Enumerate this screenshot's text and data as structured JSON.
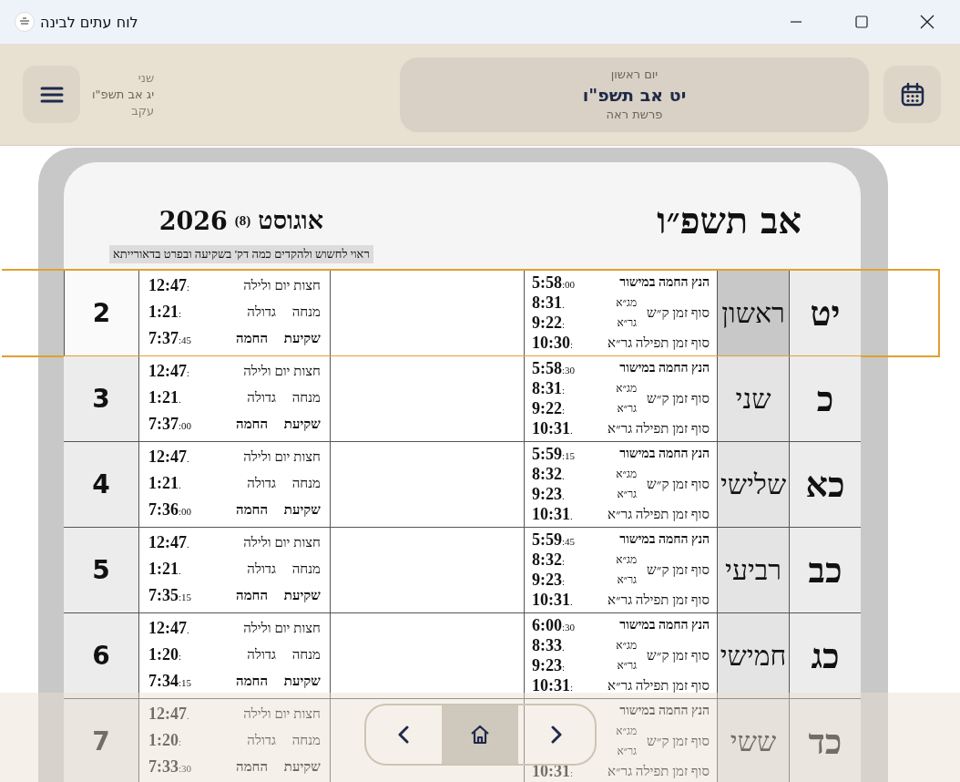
{
  "window": {
    "title": "לוח עתים לבינה"
  },
  "header": {
    "side_day": {
      "weekday": "שני",
      "date": "יג אב תשפ\"ו",
      "parasha": "עקב"
    },
    "current_day": {
      "weekday": "יום ראשון",
      "date": "יט אב תשפ\"ו",
      "parasha": "פרשת ראה"
    }
  },
  "page": {
    "hebrew_month": "אב תשפ״ו",
    "gregorian_month": "אוגוסט",
    "gregorian_month_number": "(8)",
    "gregorian_year": "2026",
    "note": "ראוי לחשוש ולהקדים כמה דק' בשקיעה ובפרט בדאורייתא"
  },
  "rows": [
    {
      "day": "יט",
      "weekday": "ראשון",
      "date": "2",
      "selected": true,
      "morning": {
        "sunrise": {
          "label": "הנץ החמה במישור",
          "time": "5:58",
          "mark": ":00"
        },
        "shema": {
          "label": "סוף זמן ק״ש",
          "opinions": [
            {
              "label": "מג״א",
              "time": "8:31",
              "mark": "."
            },
            {
              "label": "גר״א",
              "time": "9:22",
              "mark": ":"
            }
          ]
        },
        "tefila": {
          "label": "סוף זמן תפילה גר״א",
          "time": "10:30",
          "mark": ":"
        }
      },
      "afternoon": [
        {
          "label": "חצות יום ולילה",
          "time": "12:47",
          "mark": ":"
        },
        {
          "label": "מנחה גדולה",
          "time": "1:21",
          "mark": ":"
        },
        {
          "label": "שקיעת החמה",
          "time": "7:37",
          "mark": ":45"
        }
      ]
    },
    {
      "day": "כ",
      "weekday": "שני",
      "date": "3",
      "selected": false,
      "morning": {
        "sunrise": {
          "label": "הנץ החמה במישור",
          "time": "5:58",
          "mark": ":30"
        },
        "shema": {
          "label": "סוף זמן ק״ש",
          "opinions": [
            {
              "label": "מג״א",
              "time": "8:31",
              "mark": ":"
            },
            {
              "label": "גר״א",
              "time": "9:22",
              "mark": ":"
            }
          ]
        },
        "tefila": {
          "label": "סוף זמן תפילה גר״א",
          "time": "10:31",
          "mark": "."
        }
      },
      "afternoon": [
        {
          "label": "חצות יום ולילה",
          "time": "12:47",
          "mark": ":"
        },
        {
          "label": "מנחה גדולה",
          "time": "1:21",
          "mark": "."
        },
        {
          "label": "שקיעת החמה",
          "time": "7:37",
          "mark": ":00"
        }
      ]
    },
    {
      "day": "כא",
      "weekday": "שלישי",
      "date": "4",
      "selected": false,
      "morning": {
        "sunrise": {
          "label": "הנץ החמה במישור",
          "time": "5:59",
          "mark": ":15"
        },
        "shema": {
          "label": "סוף זמן ק״ש",
          "opinions": [
            {
              "label": "מג״א",
              "time": "8:32",
              "mark": "."
            },
            {
              "label": "גר״א",
              "time": "9:23",
              "mark": "."
            }
          ]
        },
        "tefila": {
          "label": "סוף זמן תפילה גר״א",
          "time": "10:31",
          "mark": "."
        }
      },
      "afternoon": [
        {
          "label": "חצות יום ולילה",
          "time": "12:47",
          "mark": "."
        },
        {
          "label": "מנחה גדולה",
          "time": "1:21",
          "mark": "."
        },
        {
          "label": "שקיעת החמה",
          "time": "7:36",
          "mark": ":00"
        }
      ]
    },
    {
      "day": "כב",
      "weekday": "רביעי",
      "date": "5",
      "selected": false,
      "morning": {
        "sunrise": {
          "label": "הנץ החמה במישור",
          "time": "5:59",
          "mark": ":45"
        },
        "shema": {
          "label": "סוף זמן ק״ש",
          "opinions": [
            {
              "label": "מג״א",
              "time": "8:32",
              "mark": ":"
            },
            {
              "label": "גר״א",
              "time": "9:23",
              "mark": ":"
            }
          ]
        },
        "tefila": {
          "label": "סוף זמן תפילה גר״א",
          "time": "10:31",
          "mark": "."
        }
      },
      "afternoon": [
        {
          "label": "חצות יום ולילה",
          "time": "12:47",
          "mark": "."
        },
        {
          "label": "מנחה גדולה",
          "time": "1:21",
          "mark": "."
        },
        {
          "label": "שקיעת החמה",
          "time": "7:35",
          "mark": ":15"
        }
      ]
    },
    {
      "day": "כג",
      "weekday": "חמישי",
      "date": "6",
      "selected": false,
      "morning": {
        "sunrise": {
          "label": "הנץ החמה במישור",
          "time": "6:00",
          "mark": ":30"
        },
        "shema": {
          "label": "סוף זמן ק״ש",
          "opinions": [
            {
              "label": "מג״א",
              "time": "8:33",
              "mark": "."
            },
            {
              "label": "גר״א",
              "time": "9:23",
              "mark": ":"
            }
          ]
        },
        "tefila": {
          "label": "סוף זמן תפילה גר״א",
          "time": "10:31",
          "mark": ":"
        }
      },
      "afternoon": [
        {
          "label": "חצות יום ולילה",
          "time": "12:47",
          "mark": "."
        },
        {
          "label": "מנחה גדולה",
          "time": "1:20",
          "mark": ":"
        },
        {
          "label": "שקיעת החמה",
          "time": "7:34",
          "mark": ":15"
        }
      ]
    },
    {
      "day": "כד",
      "weekday": "ששי",
      "date": "7",
      "selected": false,
      "morning": {
        "sunrise": {
          "label": "הנץ החמה במישור"
        },
        "shema": {
          "label": "סוף זמן ק״ש",
          "opinions": [
            {
              "label": "מג״א"
            },
            {
              "label": "גר״א"
            }
          ]
        },
        "tefila": {
          "label": "סוף זמן תפילה גר״א",
          "time": "10:31",
          "mark": ":"
        }
      },
      "afternoon": [
        {
          "label": "חצות יום ולילה",
          "time": "12:47",
          "mark": "."
        },
        {
          "label": "מנחה גדולה",
          "time": "1:20",
          "mark": ":"
        },
        {
          "label": "שקיעת החמה",
          "time": "7:33",
          "mark": ":30"
        }
      ]
    }
  ]
}
